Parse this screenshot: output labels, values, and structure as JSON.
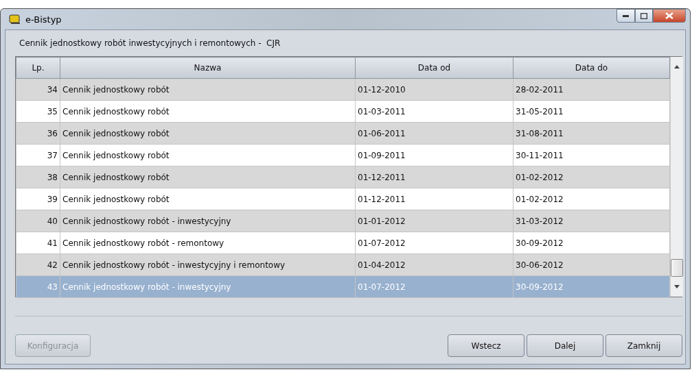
{
  "window": {
    "title": "e-Bistyp"
  },
  "heading": "Cennik jednostkowy robót inwestycyjnych i remontowych -  CJR",
  "table": {
    "columns": [
      "Lp.",
      "Nazwa",
      "Data od",
      "Data do"
    ],
    "rows": [
      {
        "cells": [
          "34",
          "Cennik jednostkowy robót",
          "01-12-2010",
          "28-02-2011"
        ],
        "selected": false
      },
      {
        "cells": [
          "35",
          "Cennik jednostkowy robót",
          "01-03-2011",
          "31-05-2011"
        ],
        "selected": false
      },
      {
        "cells": [
          "36",
          "Cennik jednostkowy robót",
          "01-06-2011",
          "31-08-2011"
        ],
        "selected": false
      },
      {
        "cells": [
          "37",
          "Cennik jednostkowy robót",
          "01-09-2011",
          "30-11-2011"
        ],
        "selected": false
      },
      {
        "cells": [
          "38",
          "Cennik jednostkowy robót",
          "01-12-2011",
          "01-02-2012"
        ],
        "selected": false
      },
      {
        "cells": [
          "39",
          "Cennik jednostkowy robót",
          "01-12-2011",
          "01-02-2012"
        ],
        "selected": false
      },
      {
        "cells": [
          "40",
          "Cennik jednostkowy robót - inwestycyjny",
          "01-01-2012",
          "31-03-2012"
        ],
        "selected": false
      },
      {
        "cells": [
          "41",
          "Cennik jednostkowy robót - remontowy",
          "01-07-2012",
          "30-09-2012"
        ],
        "selected": false
      },
      {
        "cells": [
          "42",
          "Cennik jednostkowy robót - inwestycyjny i remontowy",
          "01-04-2012",
          "30-06-2012"
        ],
        "selected": false
      },
      {
        "cells": [
          "43",
          "Cennik jednostkowy robót - inwestycyjny",
          "01-07-2012",
          "30-09-2012"
        ],
        "selected": true
      }
    ]
  },
  "left_buttons": [
    {
      "label": "Konfiguracja",
      "disabled": true
    }
  ],
  "right_buttons": [
    {
      "label": "Wstecz",
      "disabled": false
    },
    {
      "label": "Dalej",
      "disabled": false
    },
    {
      "label": "Zamknij",
      "disabled": false
    }
  ]
}
